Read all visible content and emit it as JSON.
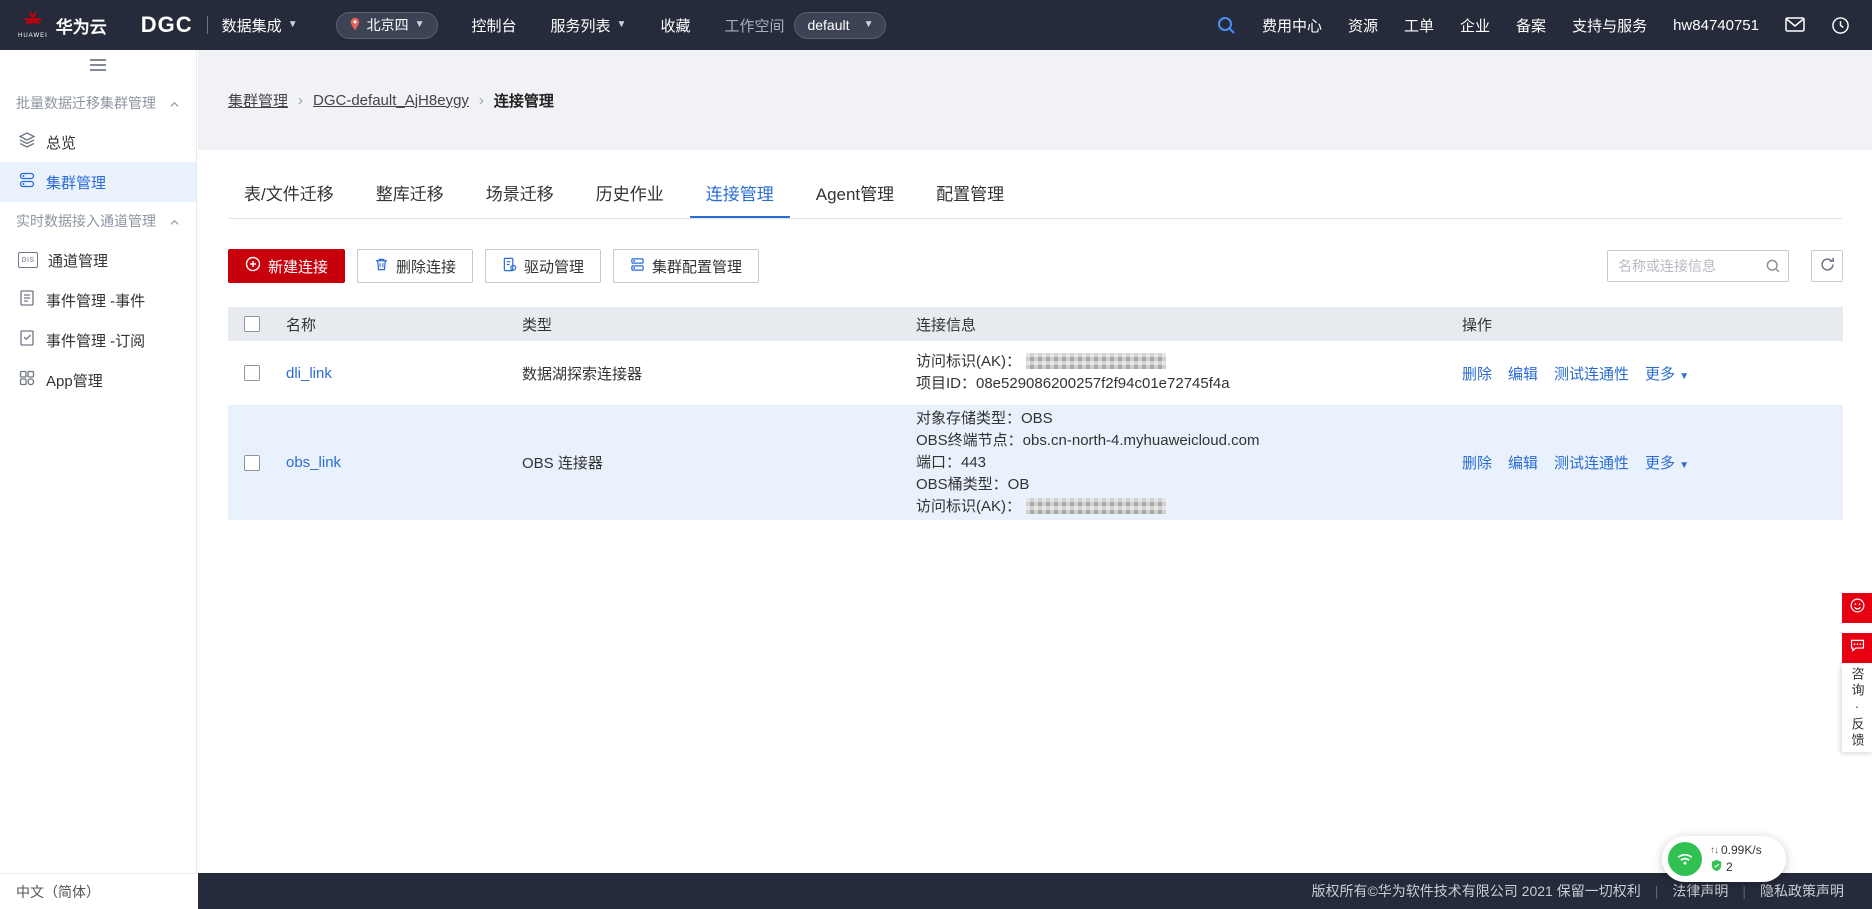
{
  "colors": {
    "topbar": "#252b3a",
    "accent": "#2b6cd4",
    "brand_red": "#c7000b",
    "row_highlight": "#e9f2fc",
    "green": "#31c153"
  },
  "topnav": {
    "logo_text": "华为云",
    "logo_brand": "HUAWEI",
    "product": "DGC",
    "product_menu": "数据集成",
    "region": "北京四",
    "console": "控制台",
    "services": "服务列表",
    "favorites": "收藏",
    "workspace_label": "工作空间",
    "workspace_value": "default",
    "billing": "费用中心",
    "resources": "资源",
    "tickets": "工单",
    "enterprise": "企业",
    "beian": "备案",
    "support": "支持与服务",
    "username": "hw84740751"
  },
  "sidebar": {
    "group1_label": "批量数据迁移集群管理",
    "group2_label": "实时数据接入通道管理",
    "item_overview": "总览",
    "item_cluster": "集群管理",
    "item_channel": "通道管理",
    "item_event": "事件管理 -事件",
    "item_subscribe": "事件管理 -订阅",
    "item_app": "App管理",
    "dis_label": "DIS"
  },
  "breadcrumb": {
    "level1": "集群管理",
    "level2": "DGC-default_AjH8eygy",
    "level3": "连接管理"
  },
  "tabs": {
    "t0": "表/文件迁移",
    "t1": "整库迁移",
    "t2": "场景迁移",
    "t3": "历史作业",
    "t4": "连接管理",
    "t5": "Agent管理",
    "t6": "配置管理"
  },
  "toolbar": {
    "new": "新建连接",
    "delete": "删除连接",
    "driver": "驱动管理",
    "cluster_config": "集群配置管理"
  },
  "search": {
    "placeholder": "名称或连接信息"
  },
  "table": {
    "col_name": "名称",
    "col_type": "类型",
    "col_info": "连接信息",
    "col_actions": "操作",
    "actions": {
      "delete": "删除",
      "edit": "编辑",
      "test": "测试连通性",
      "more": "更多"
    },
    "rows": [
      {
        "name": "dli_link",
        "type": "数据湖探索连接器",
        "ak_label": "访问标识(AK)：",
        "line2": "项目ID：08e529086200257f2f94c01e72745f4a"
      },
      {
        "name": "obs_link",
        "type": "OBS 连接器",
        "line1": "对象存储类型：OBS",
        "line2": "OBS终端节点：obs.cn-north-4.myhuaweicloud.com",
        "line3": "端口：443",
        "line4": "OBS桶类型：OB",
        "ak_label": "访问标识(AK)："
      }
    ]
  },
  "footer": {
    "language": "中文（简体）",
    "copyright": "版权所有©华为软件技术有限公司 2021 保留一切权利",
    "legal": "法律声明",
    "privacy": "隐私政策声明"
  },
  "floating": {
    "speed": "0.99K/s",
    "count": "2",
    "feedback_vertical": "咨询·反馈"
  }
}
